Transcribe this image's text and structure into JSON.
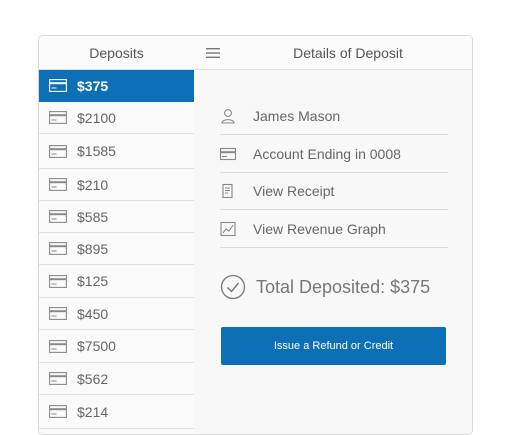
{
  "left_panel": {
    "title": "Deposits",
    "items": [
      {
        "amount": "$375",
        "active": true
      },
      {
        "amount": "$2100"
      },
      {
        "amount": "$1585"
      },
      {
        "amount": "$210"
      },
      {
        "amount": "$585"
      },
      {
        "amount": "$895"
      },
      {
        "amount": "$125"
      },
      {
        "amount": "$450"
      },
      {
        "amount": "$7500"
      },
      {
        "amount": "$562"
      },
      {
        "amount": "$214"
      }
    ]
  },
  "right_panel": {
    "title": "Details of Deposit",
    "details": {
      "name": "James Mason",
      "account": "Account Ending in 0008",
      "receipt_link": "View Receipt",
      "graph_link": "View Revenue Graph"
    },
    "total": "Total Deposited: $375",
    "refund_button": "Issue a Refund or Credit"
  },
  "colors": {
    "accent": "#0d6fb5",
    "border": "#d9d9d9"
  },
  "icons": [
    "card-icon",
    "menu-icon",
    "user-icon",
    "receipt-icon",
    "graph-icon",
    "check-circle-icon"
  ]
}
